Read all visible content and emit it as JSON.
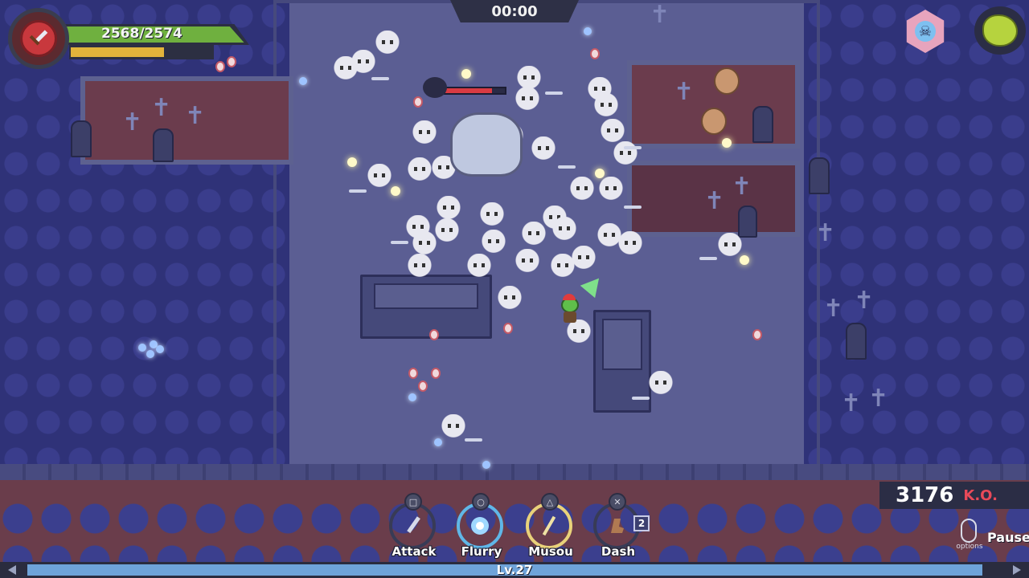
{
  "player": {
    "hp_text": "2568/2574",
    "hp_fraction": 0.998,
    "sub_bar_fraction": 0.66,
    "level_text": "Lv.27",
    "xp_fraction": 0.98
  },
  "timer": {
    "text": "00:00"
  },
  "ko": {
    "count": "3176",
    "label": "K.O."
  },
  "skills": [
    {
      "label": "Attack",
      "button": "□",
      "icon": "sword-icon",
      "ring_color": "#383b56"
    },
    {
      "label": "Flurry",
      "button": "○",
      "icon": "flurry-icon",
      "ring_color": "#5fb7e8"
    },
    {
      "label": "Musou",
      "button": "△",
      "icon": "musou-icon",
      "ring_color": "#e9d27a"
    },
    {
      "label": "Dash",
      "button": "✕",
      "icon": "dash-icon",
      "ring_color": "#383b56",
      "charges": "2"
    }
  ],
  "options": {
    "label": "options",
    "pause_label": "Pause"
  },
  "icons": {
    "hp_emblem": "sword-emblem-icon",
    "danger_badge": "skull-icon",
    "minimap": "slime-map-icon"
  },
  "colors": {
    "hp_fill": "#6fb03f",
    "sub_fill": "#e2b43b",
    "xp_fill": "#6ea3d9",
    "boss_hp": "#d93b43",
    "ko_label": "#e94a59"
  }
}
